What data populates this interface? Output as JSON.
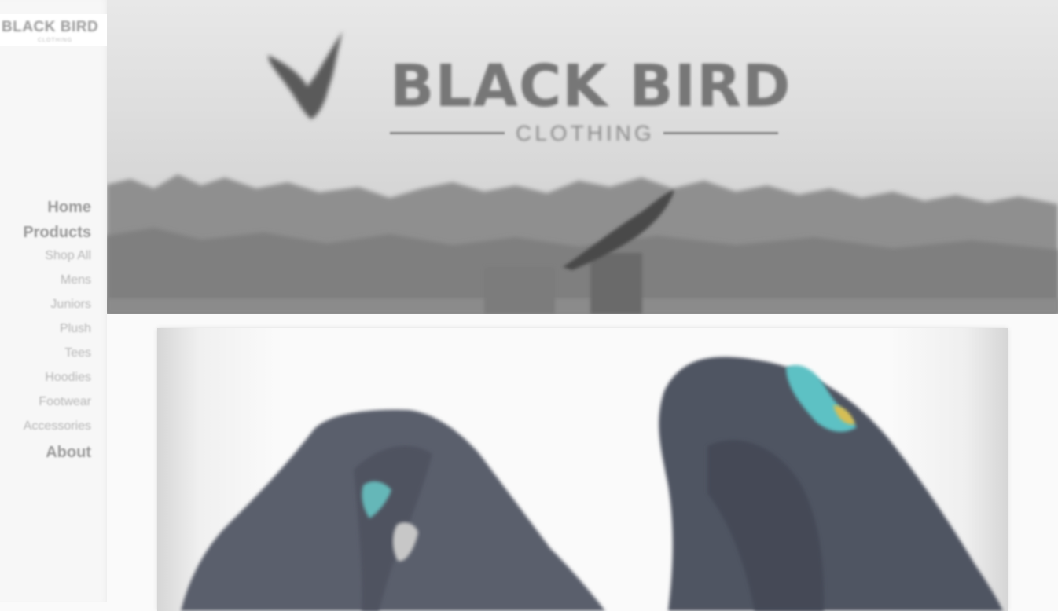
{
  "sidebar": {
    "logo": {
      "name": "BLACK BIRD",
      "subtitle": "CLOTHING"
    },
    "nav": [
      {
        "label": "Home",
        "type": "main"
      },
      {
        "label": "Products",
        "type": "main"
      },
      {
        "label": "Shop All",
        "type": "sub"
      },
      {
        "label": "Mens",
        "type": "sub"
      },
      {
        "label": "Juniors",
        "type": "sub"
      },
      {
        "label": "Plush",
        "type": "sub"
      },
      {
        "label": "Tees",
        "type": "sub"
      },
      {
        "label": "Hoodies",
        "type": "sub"
      },
      {
        "label": "Footwear",
        "type": "sub"
      },
      {
        "label": "Accessories",
        "type": "sub"
      },
      {
        "label": "About",
        "type": "main"
      }
    ]
  },
  "header": {
    "brand_title": "BLACK BIRD",
    "brand_subtitle": "CLOTHING"
  },
  "product": {
    "image_alt": "hoodie-photo"
  }
}
